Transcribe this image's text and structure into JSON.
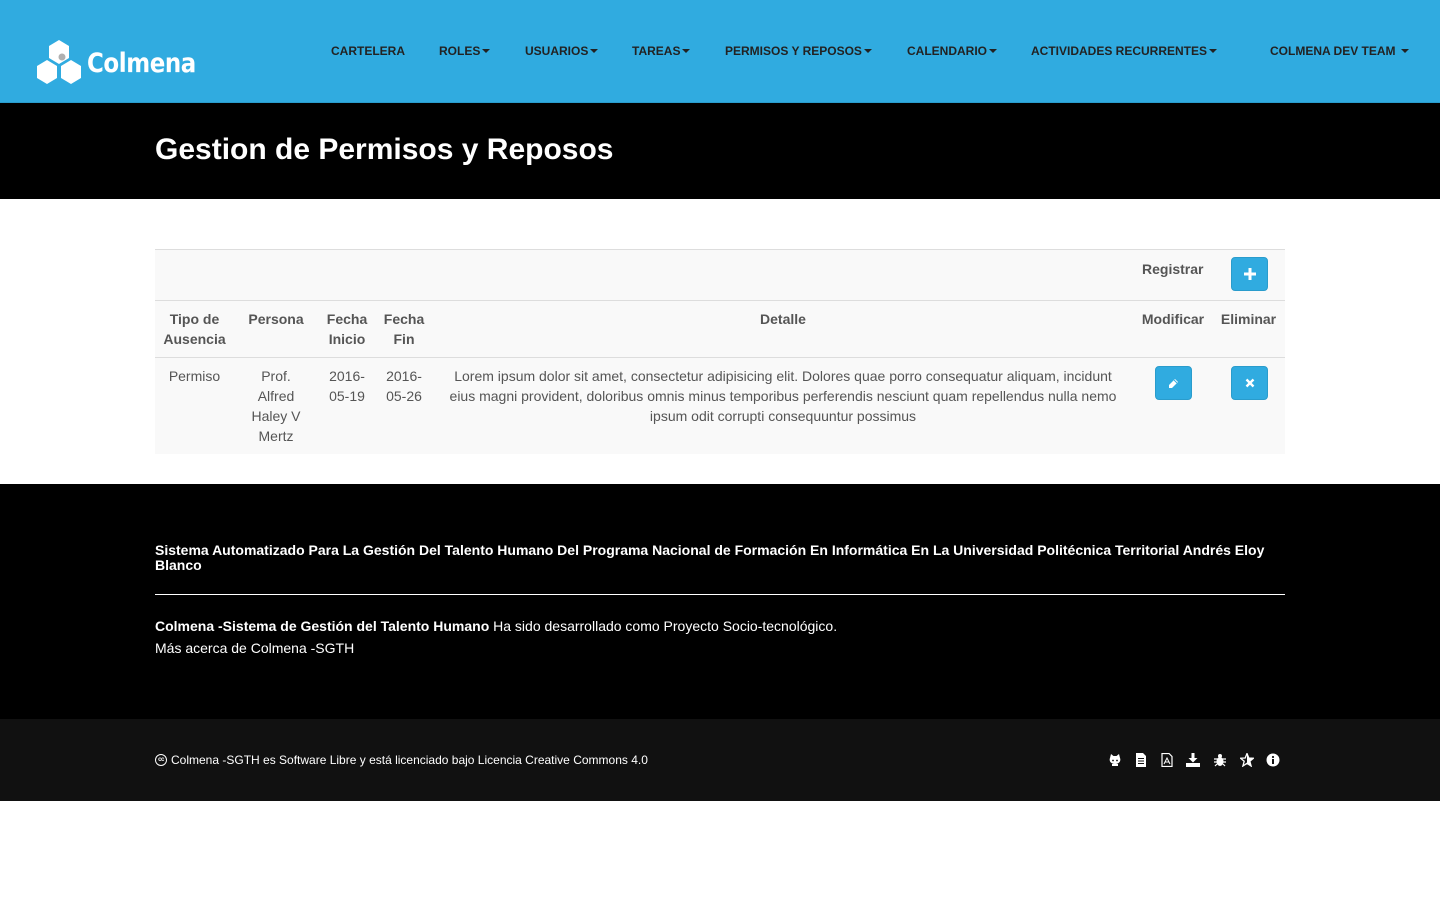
{
  "brand": {
    "name": "Colmena"
  },
  "nav": {
    "items": [
      {
        "label": "CARTELERA",
        "dropdown": false
      },
      {
        "label": "ROLES",
        "dropdown": true
      },
      {
        "label": "USUARIOS",
        "dropdown": true
      },
      {
        "label": "TAREAS",
        "dropdown": true
      },
      {
        "label": "PERMISOS Y REPOSOS",
        "dropdown": true
      },
      {
        "label": "CALENDARIO",
        "dropdown": true
      },
      {
        "label": "ACTIVIDADES RECURRENTES",
        "dropdown": true
      }
    ],
    "user_menu": "COLMENA DEV TEAM "
  },
  "header": {
    "title": "Gestion de Permisos y Reposos"
  },
  "table": {
    "register_label": "Registrar",
    "columns": {
      "tipo": [
        "Tipo de",
        "Ausencia"
      ],
      "persona": "Persona",
      "fecha_inicio": [
        "Fecha",
        "Inicio"
      ],
      "fecha_fin": [
        "Fecha",
        "Fin"
      ],
      "detalle": "Detalle",
      "modificar": "Modificar",
      "eliminar": "Eliminar"
    },
    "rows": [
      {
        "tipo": "Permiso",
        "persona": [
          "Prof.",
          "Alfred",
          "Haley V",
          "Mertz"
        ],
        "fecha_inicio": [
          "2016-",
          "05-19"
        ],
        "fecha_fin": [
          "2016-",
          "05-26"
        ],
        "detalle": "Lorem ipsum dolor sit amet, consectetur adipisicing elit. Dolores quae porro consequatur aliquam, incidunt eius magni provident, doloribus omnis minus temporibus perferendis nesciunt quam repellendus nulla nemo ipsum odit corrupti consequuntur possimus"
      }
    ]
  },
  "footer": {
    "title": "Sistema Automatizado Para La Gestión Del Talento Humano Del Programa Nacional de Formación En Informática En La Universidad Politécnica Territorial Andrés Eloy Blanco",
    "description_bold": "Colmena -Sistema de Gestión del Talento Humano",
    "description_rest": " Ha sido desarrollado como Proyecto Socio-tecnológico.",
    "more_link": "Más acerca de Colmena -SGTH",
    "cc_symbol": "cc",
    "license": "Colmena -SGTH es Software Libre y está licenciado bajo Licencia Creative Commons 4.0",
    "icons": [
      "github-icon",
      "document-icon",
      "pdf-icon",
      "download-icon",
      "bug-icon",
      "star-icon",
      "info-icon"
    ]
  },
  "colors": {
    "navbar": "#30abe0",
    "header": "#000000",
    "accent_button": "#30abe0",
    "footer": "#000000",
    "bottom_bar": "#111111"
  }
}
